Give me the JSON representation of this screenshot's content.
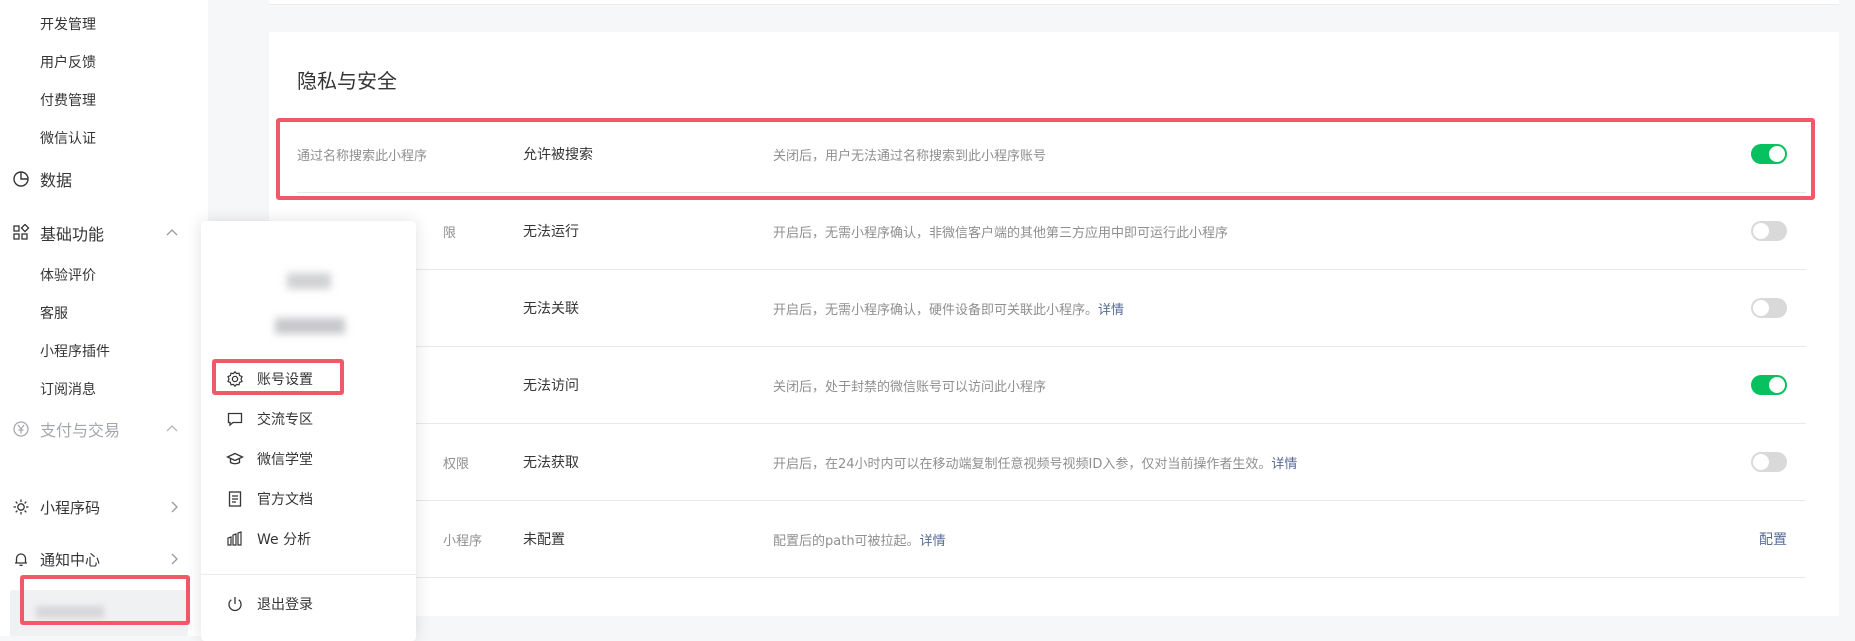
{
  "sidebar": {
    "top_items": [
      "开发管理",
      "用户反馈",
      "付费管理",
      "微信认证"
    ],
    "data_label": "数据",
    "basic_label": "基础功能",
    "basic_items": [
      "体验评价",
      "客服",
      "小程序插件",
      "订阅消息"
    ],
    "pay_label": "支付与交易",
    "qrcode_label": "小程序码",
    "notify_label": "通知中心"
  },
  "menu": {
    "items": [
      "账号设置",
      "交流专区",
      "微信学堂",
      "官方文档",
      "We 分析"
    ],
    "logout": "退出登录"
  },
  "privacy": {
    "title": "隐私与安全",
    "rows": [
      {
        "label": "通过名称搜索此小程序",
        "status": "允许被搜索",
        "desc": "关闭后，用户无法通过名称搜索到此小程序账号",
        "link": "",
        "toggle": true
      },
      {
        "label": "限",
        "status": "无法运行",
        "desc": "开启后，无需小程序确认，非微信客户端的其他第三方应用中即可运行此小程序",
        "link": "",
        "toggle": false
      },
      {
        "label": "",
        "status": "无法关联",
        "desc": "开启后，无需小程序确认，硬件设备即可关联此小程序。",
        "link": "详情",
        "toggle": false
      },
      {
        "label": "",
        "status": "无法访问",
        "desc": "关闭后，处于封禁的微信账号可以访问此小程序",
        "link": "",
        "toggle": true
      },
      {
        "label": "权限",
        "status": "无法获取",
        "desc": "开启后，在24小时内可以在移动端复制任意视频号视频ID入参，仅对当前操作者生效。",
        "link": "详情",
        "toggle": false
      },
      {
        "label": "小程序",
        "status": "未配置",
        "desc": "配置后的path可被拉起。",
        "link": "详情",
        "action": "配置"
      }
    ]
  },
  "colors": {
    "accent": "#07c160",
    "link": "#576b95",
    "highlight": "#f25968"
  }
}
